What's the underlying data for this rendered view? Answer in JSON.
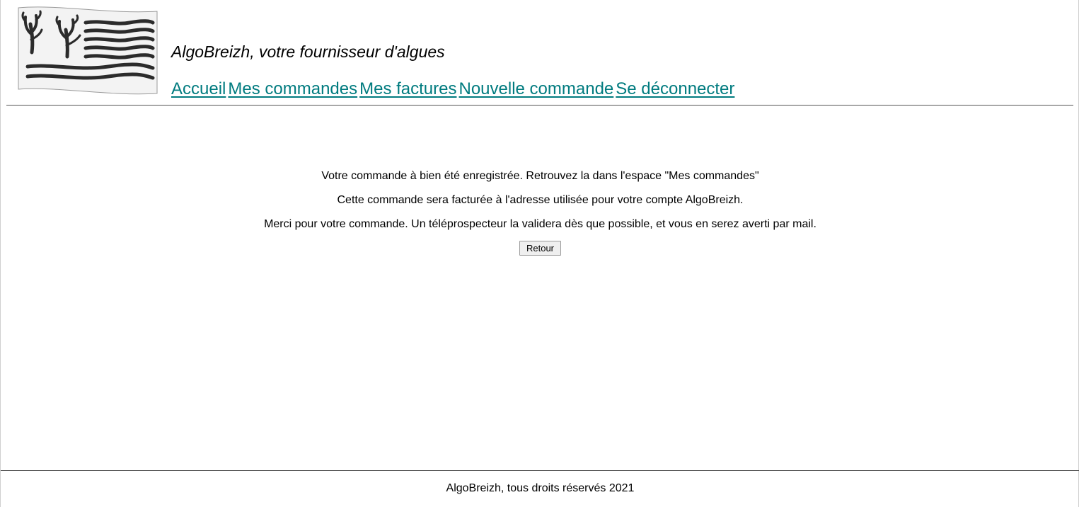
{
  "header": {
    "logo_alt": "Logo AlgoBreizh",
    "site_title": "AlgoBreizh, votre fournisseur d'algues",
    "nav": [
      {
        "label": "Accueil"
      },
      {
        "label": "Mes commandes"
      },
      {
        "label": "Mes factures"
      },
      {
        "label": "Nouvelle commande"
      },
      {
        "label": "Se déconnecter"
      }
    ]
  },
  "main": {
    "confirmation_line_1": "Votre commande à bien été enregistrée. Retrouvez la dans l'espace \"Mes commandes\"",
    "confirmation_line_2": "Cette commande sera facturée à l'adresse utilisée pour votre compte AlgoBreizh.",
    "confirmation_line_3": "Merci pour votre commande. Un téléprospecteur la validera dès que possible, et vous en serez averti par mail.",
    "back_button_label": "Retour"
  },
  "footer": {
    "copyright": "AlgoBreizh, tous droits réservés 2021"
  },
  "colors": {
    "link": "#007b7f",
    "divider": "#555555",
    "logo_ink": "#2b2b2b"
  },
  "icons": {
    "logo": "seaweed-flag-logo"
  }
}
